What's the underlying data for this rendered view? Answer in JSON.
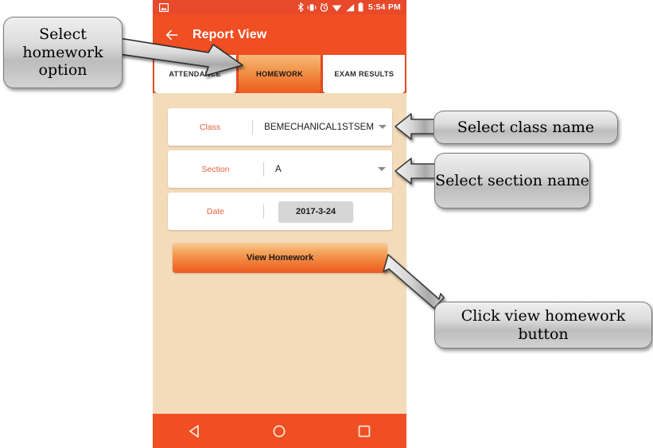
{
  "statusbar": {
    "time": "5:54 PM",
    "icons": [
      "image-icon",
      "bluetooth-icon",
      "vibrate-icon",
      "alarm-icon",
      "wifi-icon",
      "cellular-signal-icon",
      "battery-icon"
    ]
  },
  "appbar": {
    "back_icon": "back-arrow-icon",
    "title": "Report View"
  },
  "tabs": [
    {
      "label": "ATTENDANCE",
      "active": false
    },
    {
      "label": "HOMEWORK",
      "active": true
    },
    {
      "label": "EXAM RESULTS",
      "active": false
    }
  ],
  "form": {
    "class": {
      "label": "Class",
      "value": "BEMECHANICAL1STSEM",
      "caret": "chevron-down-icon"
    },
    "section": {
      "label": "Section",
      "value": "A",
      "caret": "chevron-down-icon"
    },
    "date": {
      "label": "Date",
      "value": "2017-3-24"
    }
  },
  "primary_button": {
    "label": "View Homework"
  },
  "navbar": {
    "back": "triangle-back-icon",
    "home": "circle-home-icon",
    "recents": "square-recents-icon"
  },
  "annotations": [
    {
      "id": "homework",
      "text": "Select homework option"
    },
    {
      "id": "class",
      "text": "Select class name"
    },
    {
      "id": "section",
      "text": "Select section name"
    },
    {
      "id": "view",
      "text": "Click view homework button"
    }
  ],
  "colors": {
    "status_bar": "#E8492A",
    "app_bar": "#F04E23",
    "content_bg": "#F4DCBB",
    "label_orange": "#E8603C",
    "accent_orange": "#ED5A22",
    "date_button": "#D6D6D6",
    "callout_fill": "#D2D2D2"
  }
}
